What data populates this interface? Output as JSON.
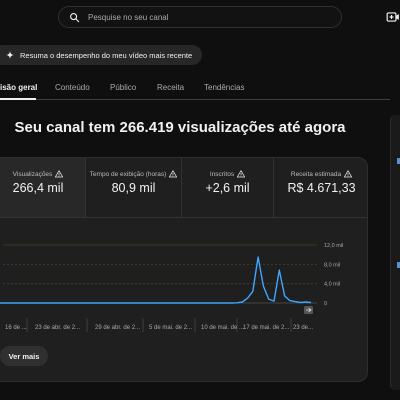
{
  "header": {
    "search_placeholder": "Pesquise no seu canal",
    "icons": {
      "search": "search-icon",
      "create": "create-video-icon"
    }
  },
  "summary_chip": {
    "label": "Resuma o desempenho do meu vídeo mais recente",
    "icon": "sparkle-icon"
  },
  "tabs": [
    {
      "label": "isão geral",
      "active": true
    },
    {
      "label": "Conteúdo",
      "active": false
    },
    {
      "label": "Público",
      "active": false
    },
    {
      "label": "Receita",
      "active": false
    },
    {
      "label": "Tendências",
      "active": false
    }
  ],
  "headline": "Seu canal tem 266.419 visualizações até agora",
  "metrics": [
    {
      "label": "Visualizações",
      "value": "266,4 mil",
      "selected": true,
      "warning_icon": "warning-icon"
    },
    {
      "label": "Tempo de exibição (horas)",
      "value": "80,9 mil",
      "selected": false,
      "warning_icon": "warning-icon"
    },
    {
      "label": "Inscritos",
      "value": "+2,6 mil",
      "selected": false,
      "warning_icon": "warning-icon"
    },
    {
      "label": "Receita estimada",
      "value": "R$ 4.671,33",
      "selected": false,
      "warning_icon": "warning-icon"
    }
  ],
  "chart_data": {
    "type": "line",
    "series": [
      {
        "values": [
          0,
          0,
          0,
          0,
          0,
          0,
          0,
          0,
          0,
          0,
          0,
          0,
          0,
          0,
          0,
          0,
          0,
          0,
          0,
          0,
          0,
          0,
          0,
          0,
          0,
          0,
          0,
          0,
          0,
          0,
          0,
          0,
          0,
          0,
          0,
          0,
          0,
          0,
          0,
          0,
          0,
          0,
          0,
          0,
          0,
          0.05,
          0.2,
          1.0,
          2.4,
          9.5,
          3.5,
          0.8,
          0.4,
          6.8,
          1.5,
          0.5,
          0.3,
          0.1,
          0.2,
          0.1
        ]
      }
    ],
    "x_tick_labels": [
      "16 de ...",
      "23 de abr. de 2...",
      "29 de abr. de 2...",
      "5 de mai. de 2...",
      "10 de mai. de ...",
      "17 de mai. de 2...",
      "23 de..."
    ],
    "y_tick_labels": [
      "12,0 mil",
      "8,0 mil",
      "4,0 mil",
      "0"
    ],
    "ylim": [
      0,
      12
    ],
    "accent_color": "#3ea6ff",
    "grid_color": "#4a4420"
  },
  "see_more_label": "Ver mais",
  "colors": {
    "background": "#0f0f0f",
    "card": "#1f1f1f",
    "accent": "#3ea6ff"
  }
}
